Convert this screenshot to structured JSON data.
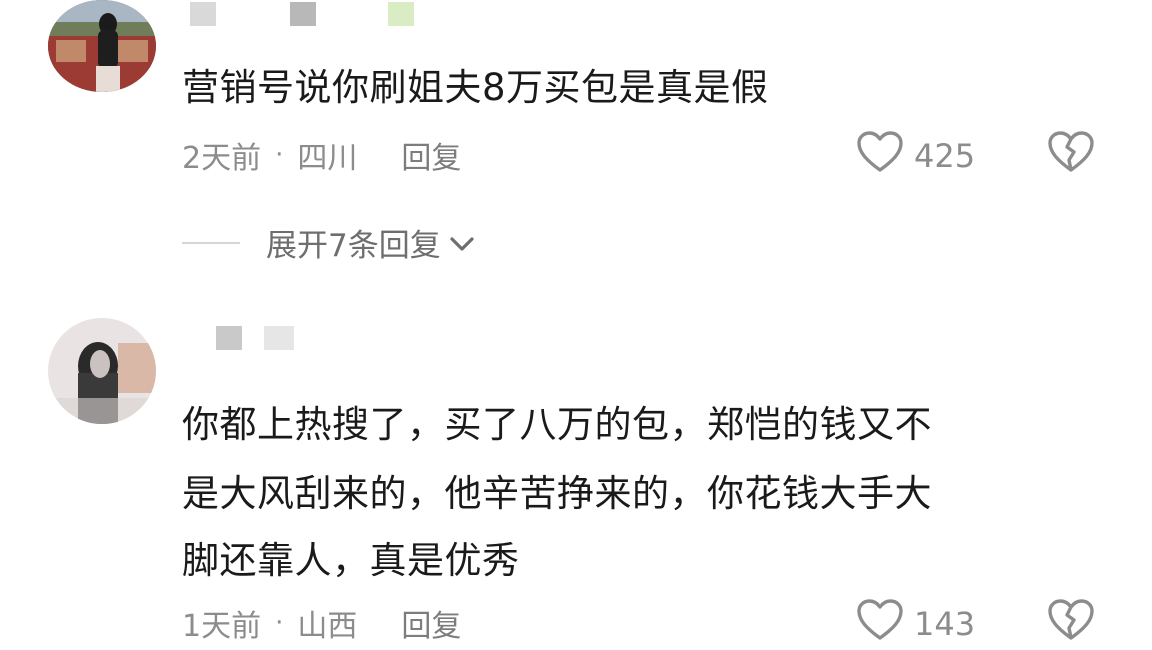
{
  "comments": [
    {
      "text": "营销号说你刷姐夫8万买包是真是假",
      "time": "2天前",
      "location": "四川",
      "reply_label": "回复",
      "likes": "425",
      "expand_label": "展开7条回复",
      "name_colors": [
        "#d9d9d9",
        "#b8b8b8",
        "#d9ecc4"
      ]
    },
    {
      "text_lines": [
        "你都上热搜了，买了八万的包，郑恺的钱又不",
        "是大风刮来的，他辛苦挣来的，你花钱大手大",
        "脚还靠人，真是优秀"
      ],
      "time": "1天前",
      "location": "山西",
      "reply_label": "回复",
      "likes": "143",
      "name_colors": [
        "#c9c9c9",
        "#e6e6e6"
      ]
    }
  ],
  "colors": {
    "text": "#1a1a1a",
    "meta": "#8c8c8c",
    "icon": "#8c8c8c"
  }
}
